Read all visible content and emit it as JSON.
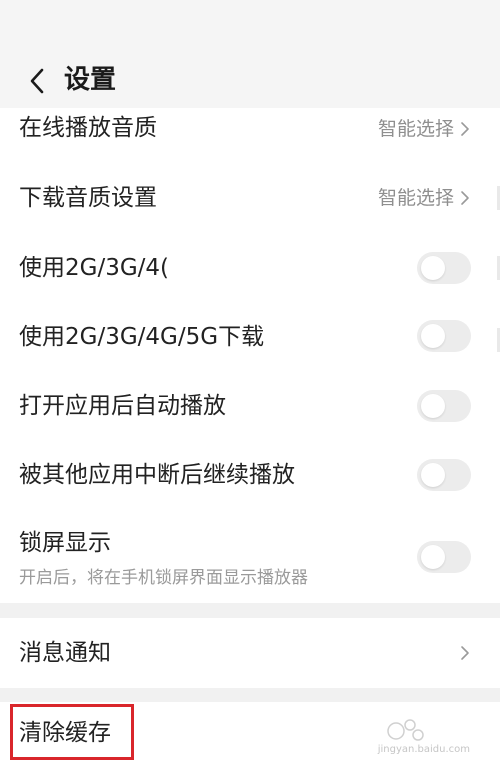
{
  "header": {
    "title": "设置",
    "back_icon": "chevron-left-icon"
  },
  "settings": {
    "playback_quality": {
      "label": "在线播放音质",
      "value": "智能选择"
    },
    "download_quality": {
      "label": "下载音质设置",
      "value": "智能选择"
    },
    "mobile_play": {
      "label": "使用2G/3G/4(",
      "enabled": false
    },
    "mobile_download": {
      "label": "使用2G/3G/4G/5G下载",
      "enabled": false
    },
    "auto_play": {
      "label": "打开应用后自动播放",
      "enabled": false
    },
    "resume_after_interrupt": {
      "label": "被其他应用中断后继续播放",
      "enabled": false
    },
    "lock_screen": {
      "label": "锁屏显示",
      "description": "开启后，将在手机锁屏界面显示播放器",
      "enabled": false
    }
  },
  "notifications": {
    "label": "消息通知"
  },
  "cache": {
    "label": "清除缓存"
  },
  "watermark": {
    "text": "jingyan.baidu.com"
  },
  "colors": {
    "highlight": "#d9262b",
    "toggle_off": "#ececec",
    "secondary_text": "#8f8f8f"
  }
}
